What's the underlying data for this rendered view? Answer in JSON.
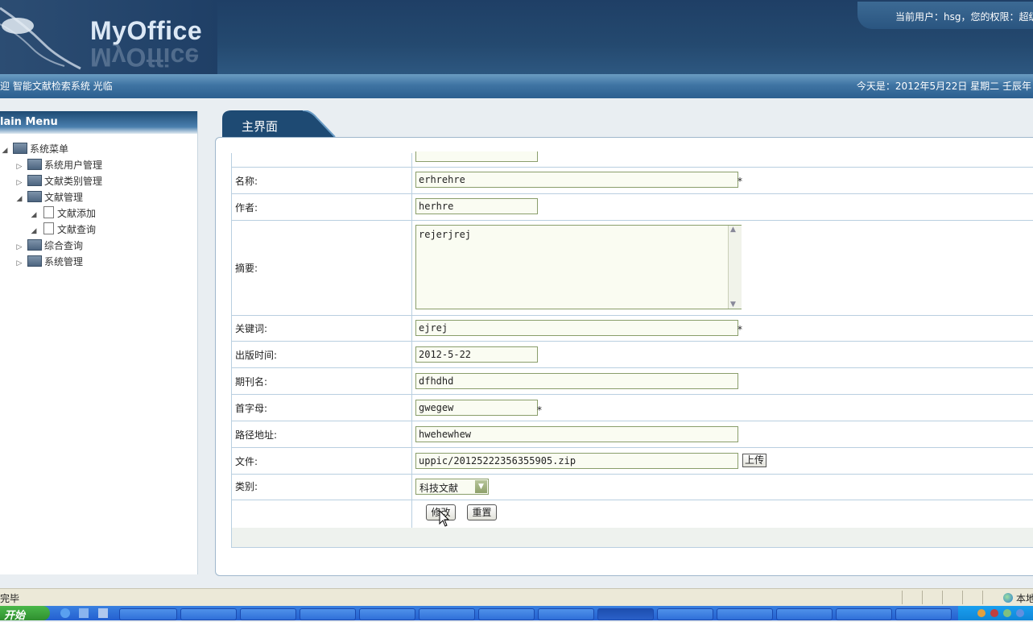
{
  "header": {
    "logo_text": "MyOffice",
    "user_info": "当前用户：hsg，您的权限：超级",
    "welcome": "迎 智能文献检索系统 光临",
    "date_text": "今天是：2012年5月22日 星期二 壬辰年"
  },
  "sidebar": {
    "title": "lain Menu",
    "items": [
      {
        "label": "系统菜单"
      },
      {
        "label": "系统用户管理"
      },
      {
        "label": "文献类别管理"
      },
      {
        "label": "文献管理"
      },
      {
        "label": "文献添加"
      },
      {
        "label": "文献查询"
      },
      {
        "label": "综合查询"
      },
      {
        "label": "系统管理"
      }
    ]
  },
  "main_tab": {
    "label": "主界面"
  },
  "form": {
    "name_label": "名称:",
    "name_value": "erhrehre",
    "author_label": "作者:",
    "author_value": "herhre",
    "abstract_label": "摘要:",
    "abstract_value": "rejerjrej",
    "keywords_label": "关键词:",
    "keywords_value": "ejrej",
    "publish_date_label": "出版时间:",
    "publish_date_value": "2012-5-22",
    "journal_label": "期刊名:",
    "journal_value": "dfhdhd",
    "initial_label": "首字母:",
    "initial_value": "gwegew",
    "path_label": "路径地址:",
    "path_value": "hwehewhew",
    "file_label": "文件:",
    "file_value": "uppic/20125222356355905.zip",
    "upload_label": "上传",
    "category_label": "类别:",
    "category_value": "科技文献",
    "required_mark": "*",
    "modify_label": "修改",
    "reset_label": "重置"
  },
  "statusbar": {
    "status_text": "完毕",
    "zone_text": "本地"
  },
  "taskbar": {
    "start_label": "开始"
  }
}
